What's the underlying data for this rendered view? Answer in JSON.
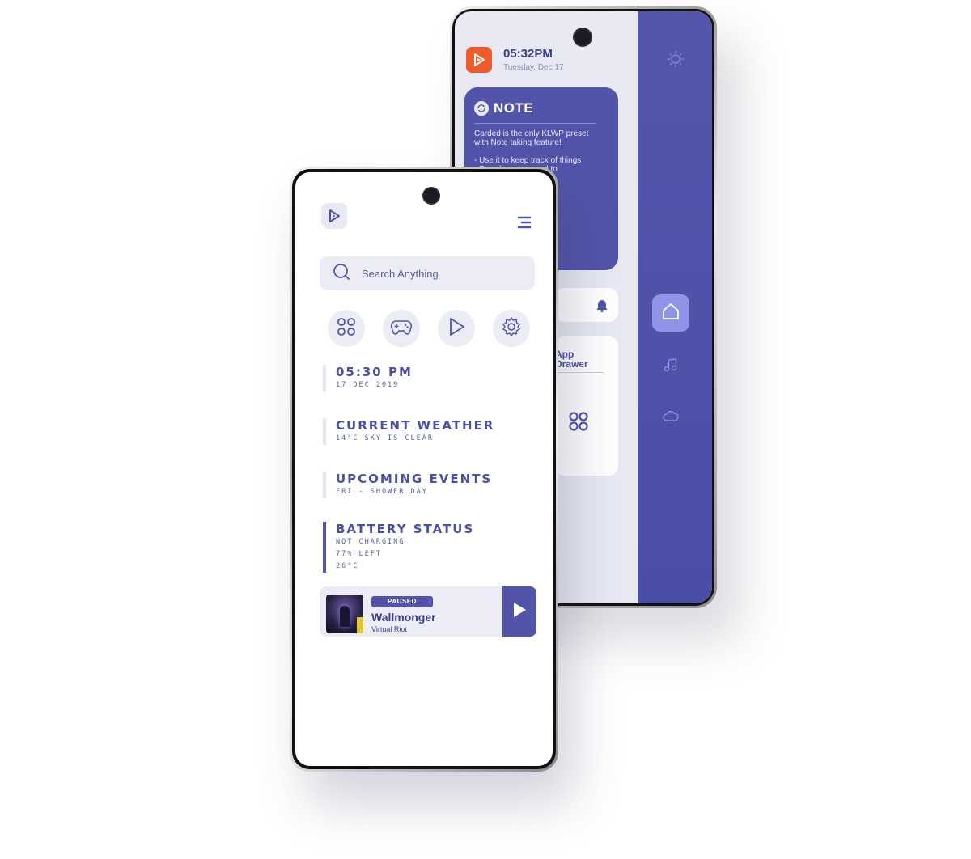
{
  "back_phone": {
    "time": "05:32PM",
    "date": "Tuesday, Dec 17",
    "note": {
      "title": "NOTE",
      "body": "Carded is the only KLWP preset\nwith Note taking feature!\n\n- Use it to keep track of things\n- For when you need to\n  something"
    },
    "app_drawer_label": "App\nDrawer",
    "sidebar_icons": [
      "sun-icon",
      "home-icon",
      "music-icon",
      "cloud-icon"
    ],
    "colors": {
      "accent": "#5254a9",
      "brand_logo": "#ef5a2a",
      "screen_bg": "#e8e9f3",
      "sidebar_active": "#8e94e8"
    }
  },
  "front_phone": {
    "search": {
      "placeholder": "Search Anything"
    },
    "quick_actions": [
      "apps-icon",
      "gamepad-icon",
      "play-icon",
      "settings-icon"
    ],
    "clock": {
      "time": "05:30 PM",
      "date": "17 DEC 2019"
    },
    "weather": {
      "title": "CURRENT WEATHER",
      "detail": "14°C SKY IS CLEAR"
    },
    "events": {
      "title": "UPCOMING EVENTS",
      "detail": "FRI - SHOWER DAY"
    },
    "battery": {
      "title": "BATTERY STATUS",
      "line1": "NOT CHARGING",
      "line2": "77% LEFT",
      "line3": "26°C"
    },
    "music": {
      "status": "PAUSED",
      "track": "Wallmonger",
      "artist": "Virtual Riot"
    }
  }
}
